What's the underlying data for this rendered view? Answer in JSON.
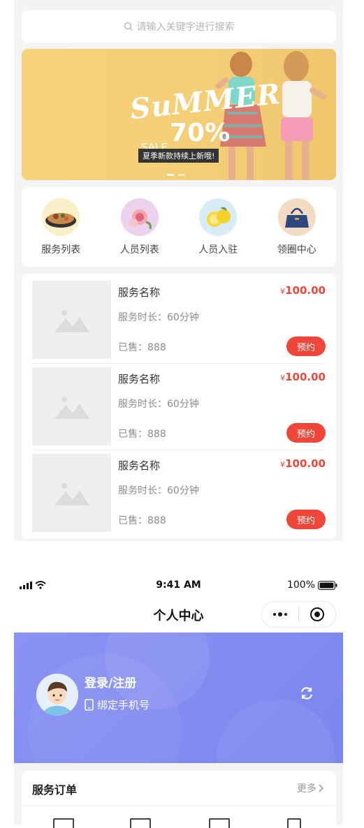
{
  "home": {
    "search_placeholder": "请输入关键字进行搜索",
    "banner": {
      "headline": "SuMMER",
      "sale_word": "SALE",
      "discount": "70%",
      "tag": "夏季新款持续上新哦!",
      "dots": 2,
      "active_dot": 0
    },
    "categories": [
      {
        "label": "服务列表",
        "icon": "food-plate-icon"
      },
      {
        "label": "人员列表",
        "icon": "flower-icon"
      },
      {
        "label": "人员入驻",
        "icon": "lemon-icon"
      },
      {
        "label": "领圈中心",
        "icon": "handbag-icon"
      }
    ],
    "services": [
      {
        "name": "服务名称",
        "price_symbol": "¥",
        "price": "100.00",
        "duration": "服务时长：60分钟",
        "sold": "已售：888",
        "action": "预约"
      },
      {
        "name": "服务名称",
        "price_symbol": "¥",
        "price": "100.00",
        "duration": "服务时长：60分钟",
        "sold": "已售：888",
        "action": "预约"
      },
      {
        "name": "服务名称",
        "price_symbol": "¥",
        "price": "100.00",
        "duration": "服务时长：60分钟",
        "sold": "已售：888",
        "action": "预约"
      }
    ]
  },
  "profile": {
    "status_bar": {
      "time": "9:41 AM",
      "battery": "100%"
    },
    "title": "个人中心",
    "capsule": {
      "more_icon": "ellipsis-icon",
      "close_icon": "target-icon"
    },
    "login_label": "登录/注册",
    "bind_phone_label": "绑定手机号",
    "orders": {
      "title": "服务订单",
      "more": "更多"
    }
  },
  "colors": {
    "accent_red": "#f0463a",
    "price_red": "#e84a3b",
    "hero_purple": "#8a93f3",
    "banner_yellow": "#f6d27a"
  }
}
